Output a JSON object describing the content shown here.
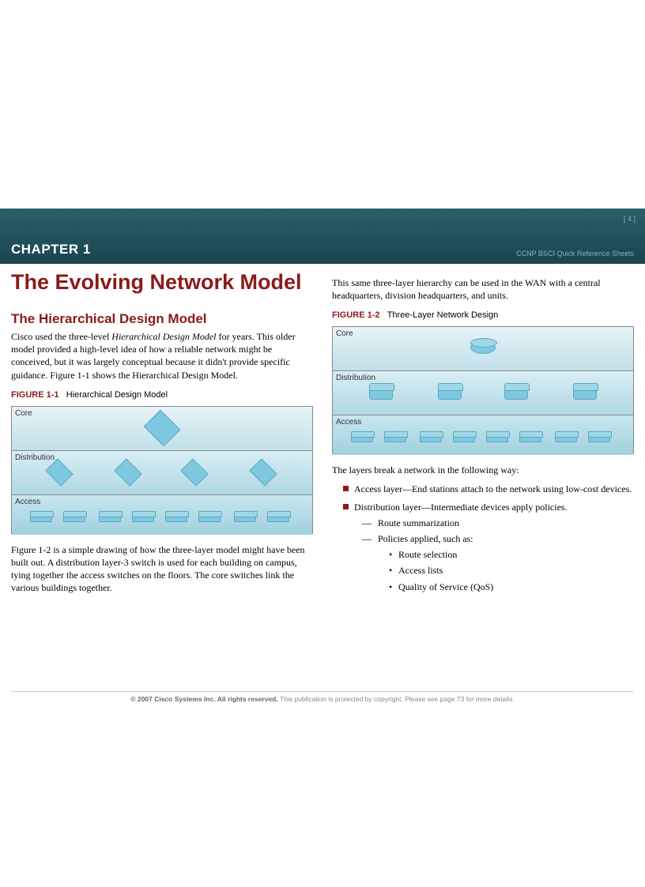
{
  "header": {
    "page_num": "[ 4 ]",
    "chapter": "CHAPTER 1",
    "ref": "CCNP BSCI Quick Reference Sheets"
  },
  "left": {
    "main_title": "The Evolving Network Model",
    "section_title": "The Hierarchical Design Model",
    "intro_a": "Cisco used the three-level ",
    "intro_b": "Hierarchical Design Model",
    "intro_c": " for years. This older model provided a high-level idea of how a reliable network might be conceived, but it was largely conceptual because it didn't provide specific guidance. Figure 1-1 shows the Hierarchical Design Model.",
    "fig1_label": "FIGURE 1-1",
    "fig1_caption": "Hierarchical Design Model",
    "layers": {
      "core": "Core",
      "dist": "Distribution",
      "access": "Access"
    },
    "para2": "Figure 1-2 is a simple drawing of how the three-layer model might have been built out. A distribution layer-3 switch is used for each building on campus, tying together the access switches on the floors. The core switches link the various buildings together."
  },
  "right": {
    "intro": "This same three-layer hierarchy can be used in the WAN with a central headquarters, division headquarters, and units.",
    "fig2_label": "FIGURE 1-2",
    "fig2_caption": "Three-Layer Network Design",
    "layers": {
      "core": "Core",
      "dist": "Distribution",
      "access": "Access"
    },
    "break_intro": "The layers break a network in the following way:",
    "bullets": {
      "access": "Access layer—End stations attach to the network using low-cost devices.",
      "dist": "Distribution layer—Intermediate devices apply policies.",
      "dist_subs": {
        "a": "Route summarization",
        "b": "Policies applied, such as:",
        "b_subs": {
          "a": "Route selection",
          "b": "Access lists",
          "c": "Quality of Service (QoS)"
        }
      }
    }
  },
  "footer": {
    "bold": "© 2007 Cisco Systems Inc. All rights reserved.",
    "rest": " This publication is protected by copyright. Please see page 73 for more details."
  }
}
